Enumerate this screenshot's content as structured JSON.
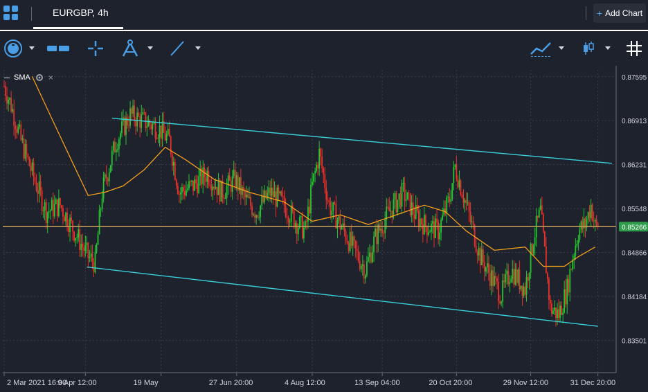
{
  "header": {
    "chart_tab": "EURGBP, 4h",
    "add_chart_label": "Add Chart"
  },
  "indicator_legend": {
    "label": "SMA"
  },
  "colors": {
    "background": "#1e222d",
    "bull_candle": "#26c431",
    "bear_candle": "#e8312a",
    "sma": "#f29f1c",
    "channel": "#39d0d8",
    "price_line": "#c8a15a",
    "price_badge": "#2e9c4a",
    "accent": "#4a9ee6"
  },
  "icons": [
    "grid-app-icon",
    "interval-4h-icon",
    "ruler-icon",
    "crosshair-icon",
    "compass-icon",
    "trendline-icon",
    "indicators-icon",
    "candle-type-icon",
    "grid-hash-icon",
    "settings-icon",
    "close-icon"
  ],
  "chart_data": {
    "type": "candlestick",
    "symbol": "EURGBP",
    "interval": "4h",
    "ylim": [
      0.83,
      0.877
    ],
    "y_ticks": [
      "0.87595",
      "0.86913",
      "0.86231",
      "0.85548",
      "0.84866",
      "0.84184",
      "0.83501"
    ],
    "x_ticks": [
      "2 Mar 2021 16:00",
      "9 Apr 12:00",
      "19 May",
      "27 Jun 20:00",
      "4 Aug 12:00",
      "13 Sep 04:00",
      "20 Oct 20:00",
      "29 Nov 12:00",
      "31 Dec 20:00"
    ],
    "last_price": "0.85266",
    "last_price_value": 0.85266,
    "close_path": [
      [
        0,
        0.8745
      ],
      [
        5,
        0.8715
      ],
      [
        12,
        0.866
      ],
      [
        20,
        0.861
      ],
      [
        30,
        0.855
      ],
      [
        40,
        0.856
      ],
      [
        50,
        0.852
      ],
      [
        60,
        0.848
      ],
      [
        65,
        0.847
      ],
      [
        70,
        0.858
      ],
      [
        80,
        0.866
      ],
      [
        90,
        0.87
      ],
      [
        100,
        0.869
      ],
      [
        110,
        0.868
      ],
      [
        118,
        0.866
      ],
      [
        125,
        0.858
      ],
      [
        135,
        0.859
      ],
      [
        145,
        0.861
      ],
      [
        155,
        0.858
      ],
      [
        165,
        0.86
      ],
      [
        172,
        0.857
      ],
      [
        180,
        0.855
      ],
      [
        190,
        0.858
      ],
      [
        200,
        0.856
      ],
      [
        210,
        0.853
      ],
      [
        215,
        0.852
      ],
      [
        220,
        0.859
      ],
      [
        225,
        0.864
      ],
      [
        232,
        0.856
      ],
      [
        240,
        0.853
      ],
      [
        250,
        0.849
      ],
      [
        258,
        0.846
      ],
      [
        265,
        0.851
      ],
      [
        275,
        0.855
      ],
      [
        285,
        0.858
      ],
      [
        292,
        0.855
      ],
      [
        300,
        0.853
      ],
      [
        310,
        0.852
      ],
      [
        318,
        0.857
      ],
      [
        322,
        0.862
      ],
      [
        330,
        0.856
      ],
      [
        340,
        0.848
      ],
      [
        350,
        0.844
      ],
      [
        355,
        0.842
      ],
      [
        362,
        0.846
      ],
      [
        372,
        0.843
      ],
      [
        378,
        0.851
      ],
      [
        383,
        0.855
      ],
      [
        390,
        0.84
      ],
      [
        396,
        0.839
      ],
      [
        402,
        0.843
      ],
      [
        406,
        0.848
      ],
      [
        410,
        0.852
      ],
      [
        415,
        0.853
      ],
      [
        419,
        0.856
      ],
      [
        422,
        0.8527
      ]
    ],
    "sma_path": [
      [
        20,
        0.876
      ],
      [
        35,
        0.869
      ],
      [
        48,
        0.863
      ],
      [
        60,
        0.8575
      ],
      [
        72,
        0.858
      ],
      [
        85,
        0.859
      ],
      [
        100,
        0.8615
      ],
      [
        115,
        0.865
      ],
      [
        130,
        0.863
      ],
      [
        150,
        0.86
      ],
      [
        175,
        0.858
      ],
      [
        200,
        0.8565
      ],
      [
        220,
        0.8535
      ],
      [
        240,
        0.8545
      ],
      [
        260,
        0.853
      ],
      [
        280,
        0.8545
      ],
      [
        300,
        0.856
      ],
      [
        315,
        0.855
      ],
      [
        330,
        0.852
      ],
      [
        350,
        0.849
      ],
      [
        372,
        0.8495
      ],
      [
        385,
        0.8465
      ],
      [
        400,
        0.8465
      ],
      [
        410,
        0.848
      ],
      [
        422,
        0.8495
      ]
    ],
    "channel_upper": {
      "from": [
        77,
        0.8695
      ],
      "to": [
        434,
        0.8625
      ]
    },
    "channel_lower": {
      "from": [
        59,
        0.8464
      ],
      "to": [
        424,
        0.8372
      ]
    },
    "x_tick_bars": [
      0,
      58,
      112,
      166,
      220,
      270,
      323,
      376,
      424
    ]
  }
}
